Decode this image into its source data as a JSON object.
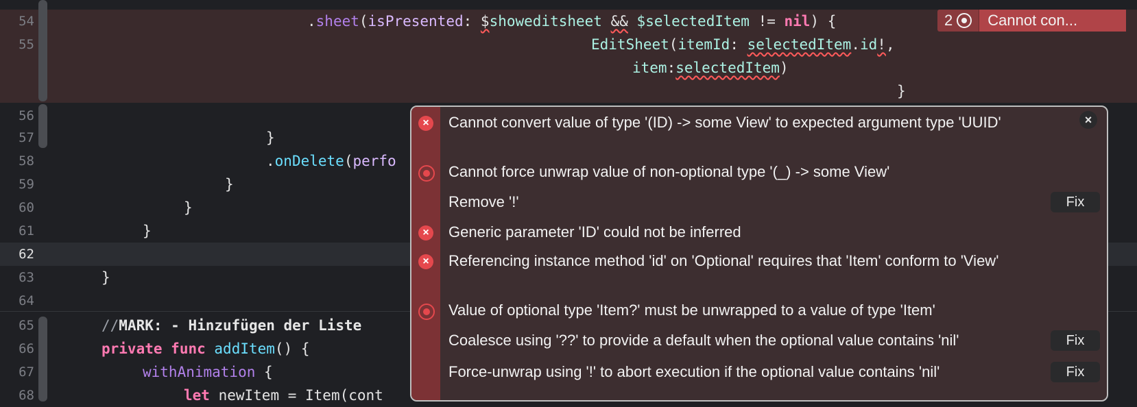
{
  "editor": {
    "gutter": [
      "54",
      "55",
      "56",
      "57",
      "58",
      "59",
      "60",
      "61",
      "62",
      "63",
      "64",
      "65",
      "66",
      "67",
      "68"
    ],
    "lines": {
      "l54": [
        ".",
        "sheet",
        "(",
        "isPresented",
        ": ",
        "$",
        "showeditsheet",
        " ",
        "&&",
        " ",
        "$",
        "selectedItem",
        " != ",
        "nil",
        ") {"
      ],
      "l55a": [
        "EditSheet",
        "(",
        "itemId",
        ": ",
        "selectedItem",
        ".",
        "id",
        "!",
        ","
      ],
      "l55b": [
        "item",
        ":",
        "selectedItem",
        ")"
      ],
      "l55c": "}",
      "l57": "}",
      "l58": [
        ".",
        "onDelete",
        "(",
        "perfo"
      ],
      "l59": "}",
      "l60": "}",
      "l61": "}",
      "l63": "}",
      "l65": [
        "//",
        "MARK:",
        " - Hinzufügen der Liste"
      ],
      "l66": [
        "private",
        " ",
        "func",
        " ",
        "addItem",
        "() {"
      ],
      "l67": [
        "withAnimation",
        " {"
      ],
      "l68": [
        "let",
        " newItem = Item(cont"
      ]
    }
  },
  "error_badge": {
    "count": "2",
    "message": "Cannot con..."
  },
  "popover": {
    "close_label": "×",
    "items": [
      {
        "icon": "error-x-icon",
        "text": "Cannot convert value of type '(ID) -> some View' to expected argument type 'UUID'"
      },
      {
        "icon": "error-dot-icon",
        "text": "Cannot force unwrap value of non-optional type '(_) -> some View'"
      },
      {
        "icon": "",
        "text": "Remove '!'",
        "fix": "Fix"
      },
      {
        "icon": "error-x-icon",
        "text": "Generic parameter 'ID' could not be inferred"
      },
      {
        "icon": "error-x-icon",
        "text": "Referencing instance method 'id' on 'Optional' requires that 'Item' conform to 'View'"
      },
      {
        "icon": "error-dot-icon",
        "text": "Value of optional type 'Item?' must be unwrapped to a value of type 'Item'"
      },
      {
        "icon": "",
        "text": "Coalesce using '??' to provide a default when the optional value contains 'nil'",
        "fix": "Fix"
      },
      {
        "icon": "",
        "text": "Force-unwrap using '!' to abort execution if the optional value contains 'nil'",
        "fix": "Fix"
      }
    ]
  }
}
